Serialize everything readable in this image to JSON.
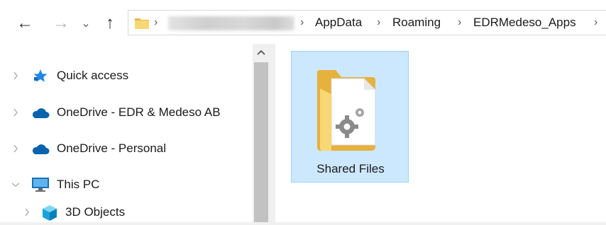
{
  "nav": {
    "back": "←",
    "forward": "→",
    "recent": "⌄",
    "up": "↑"
  },
  "address": {
    "separator": "›",
    "crumbs": [
      "AppData",
      "Roaming",
      "EDRMedeso_Apps"
    ]
  },
  "sidebar": {
    "items": [
      {
        "label": "Quick access",
        "icon": "star-icon"
      },
      {
        "label": "OneDrive - EDR & Medeso AB",
        "icon": "cloud-icon"
      },
      {
        "label": "OneDrive - Personal",
        "icon": "cloud-icon"
      },
      {
        "label": "This PC",
        "icon": "computer-icon"
      },
      {
        "label": "3D Objects",
        "icon": "cube-icon"
      }
    ]
  },
  "content": {
    "items": [
      {
        "name": "Shared Files",
        "icon": "folder-gear-icon",
        "selected": true
      }
    ]
  },
  "colors": {
    "selection": "#cce8ff",
    "selection_border": "#99d1ff",
    "folder": "#f8d775",
    "cloud": "#0a64ad",
    "star": "#1e88e5"
  }
}
